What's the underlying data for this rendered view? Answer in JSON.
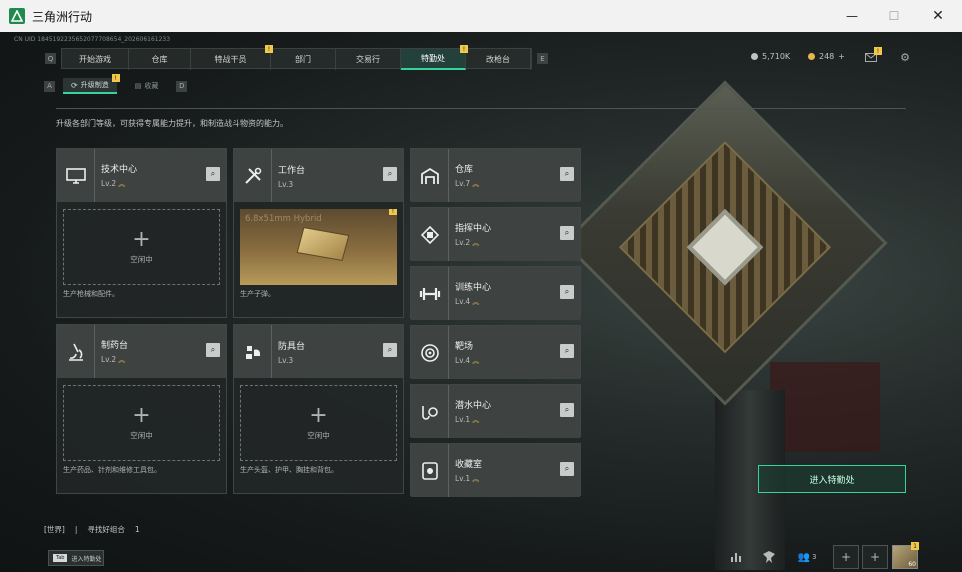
{
  "window": {
    "title": "三角洲行动",
    "minimize": "—",
    "maximize": "☐",
    "close": "✕"
  },
  "uid": "CN UID 1845192235652077708654_202606161233",
  "nav": {
    "back_key": "Q",
    "next_key": "E",
    "tabs": [
      {
        "label": "开始游戏",
        "badge": ""
      },
      {
        "label": "仓库",
        "badge": ""
      },
      {
        "label": "特战干员",
        "badge": "!"
      },
      {
        "label": "部门",
        "badge": ""
      },
      {
        "label": "交易行",
        "badge": ""
      },
      {
        "label": "特勤处",
        "badge": "!",
        "active": true
      },
      {
        "label": "改枪台",
        "badge": ""
      }
    ]
  },
  "currency": {
    "coupon": "5,710K",
    "tokens": "248",
    "plus": "+",
    "mail_badge": "!"
  },
  "subnav": {
    "prev_key": "A",
    "next_key": "D",
    "tabs": [
      {
        "label": "升级制造",
        "badge": "!",
        "active": true
      },
      {
        "label": "收藏",
        "badge": ""
      }
    ]
  },
  "description": "升级各部门等级，可获得专属能力提升，和制造战斗物资的能力。",
  "workshops": [
    {
      "name": "技术中心",
      "level": "Lv.2",
      "upgrade": true,
      "status": "空闲中",
      "desc": "生产枪械和配件。",
      "icon": "monitor-icon"
    },
    {
      "name": "工作台",
      "level": "Lv.3",
      "upgrade": false,
      "badge": "!",
      "product": "6.8x51mm Hybrid",
      "desc": "生产子弹。",
      "icon": "tools-icon"
    },
    {
      "name": "制药台",
      "level": "Lv.2",
      "upgrade": true,
      "status": "空闲中",
      "desc": "生产药品、针剂和维修工具包。",
      "icon": "microscope-icon"
    },
    {
      "name": "防具台",
      "level": "Lv.3",
      "upgrade": false,
      "status": "空闲中",
      "desc": "生产头盔、护甲、胸挂和背包。",
      "icon": "armor-icon"
    }
  ],
  "facilities": [
    {
      "name": "仓库",
      "level": "Lv.7",
      "icon": "warehouse-icon"
    },
    {
      "name": "指挥中心",
      "level": "Lv.2",
      "icon": "command-icon"
    },
    {
      "name": "训练中心",
      "level": "Lv.4",
      "icon": "dumbbell-icon"
    },
    {
      "name": "靶场",
      "level": "Lv.4",
      "icon": "target-icon"
    },
    {
      "name": "潜水中心",
      "level": "Lv.1",
      "icon": "diving-icon"
    },
    {
      "name": "收藏室",
      "level": "Lv.1",
      "icon": "collection-icon"
    }
  ],
  "mag_glyph": "⌕",
  "upgrade_glyph": "︽",
  "plus_glyph": "+",
  "enter_button": "进入特勤处",
  "chat": {
    "channel": "[世界]",
    "sep": "|",
    "text": "寻找好组合",
    "count": "1"
  },
  "tab_hint": {
    "key": "Tab",
    "label": "进入特勤处"
  },
  "bottom": {
    "friends": "3",
    "avatar_level": "60",
    "avatar_badge": "1"
  },
  "colors": {
    "accent": "#36d49a",
    "badge": "#f0c84a",
    "upgrade": "#e6b84a"
  }
}
